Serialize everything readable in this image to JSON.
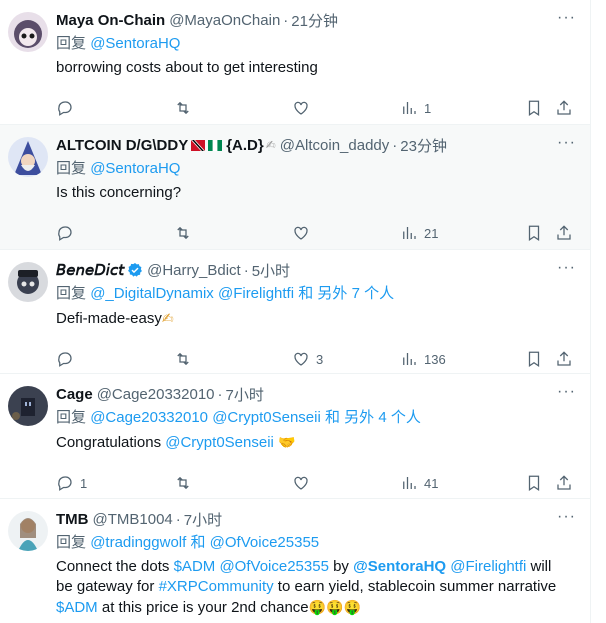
{
  "tweets": [
    {
      "name": "Maya On-Chain",
      "handle": "@MayaOnChain",
      "time": "21分钟",
      "reply_prefix": "回复",
      "reply_to": "@SentoraHQ",
      "text": "borrowing costs about to get interesting",
      "views": "1",
      "replies": "",
      "likes": ""
    },
    {
      "name": "ALTCOIN D/G\\DDY",
      "name_suffix": "{A.D}",
      "handle": "@Altcoin_daddy",
      "time": "23分钟",
      "reply_prefix": "回复",
      "reply_to": "@SentoraHQ",
      "text": "Is this concerning?",
      "views": "21",
      "replies": "",
      "likes": ""
    },
    {
      "name": "𝘉𝘦𝘯𝘦𝘋𝘪𝘤𝘵",
      "handle": "@Harry_Bdict",
      "time": "5小时",
      "reply_prefix": "回复",
      "reply_to_1": "@_DigitalDynamix",
      "reply_to_2": "@Firelightfi",
      "reply_and": "和",
      "reply_others": "另外 7 个人",
      "text": "Defi-made-easy",
      "text_emoji": "✍",
      "views": "136",
      "replies": "",
      "likes": "3"
    },
    {
      "name": "Cage",
      "handle": "@Cage20332010",
      "time": "7小时",
      "reply_prefix": "回复",
      "reply_to_1": "@Cage20332010",
      "reply_to_2": "@Crypt0Senseii",
      "reply_and": "和",
      "reply_others": "另外 4 个人",
      "text": "Congratulations",
      "text_mention": "@Crypt0Senseii",
      "text_emoji": "🤝",
      "views": "41",
      "replies": "1",
      "likes": ""
    },
    {
      "name": "TMB",
      "handle": "@TMB1004",
      "time": "7小时",
      "reply_prefix": "回复",
      "reply_to_1": "@tradinggwolf",
      "reply_and": "和",
      "reply_to_2": "@OfVoice25355",
      "text_p1": "Connect the dots",
      "text_cash1": "$ADM",
      "text_mention1": "@OfVoice25355",
      "text_by": "by",
      "text_mention2": "@SentoraHQ",
      "text_mention3": "@Firelightfi",
      "text_will": "will",
      "text_p2": "be gateway for",
      "text_hashtag": "#XRPCommunity",
      "text_p3": "to earn yield, stablecoin summer narrative",
      "text_cash2": "$ADM",
      "text_p4": "at this price is your 2nd chance",
      "text_emoji": "🤑🤑🤑"
    }
  ],
  "icons": {
    "reply": "reply-icon",
    "retweet": "retweet-icon",
    "like": "like-icon",
    "views": "views-icon",
    "bookmark": "bookmark-icon",
    "share": "share-icon",
    "more": "more-icon",
    "verified": "verified-badge-icon"
  },
  "colors": {
    "link": "#1d9bf0",
    "secondary": "#536471",
    "highlight_bg": "#f7f9f9"
  }
}
